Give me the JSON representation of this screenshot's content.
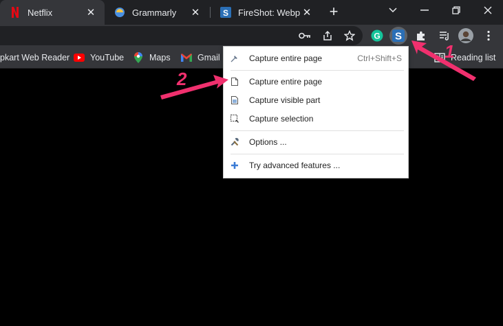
{
  "tabs": [
    {
      "title": "Netflix",
      "icon": "netflix-icon",
      "active": true
    },
    {
      "title": "Grammarly",
      "icon": "grammarly-icon",
      "active": false
    },
    {
      "title": "FireShot: Webpa",
      "icon": "fireshot-icon",
      "active": false
    }
  ],
  "bookmarks": [
    {
      "label": "pkart Web Reader",
      "icon": ""
    },
    {
      "label": "YouTube",
      "icon": "youtube-icon"
    },
    {
      "label": "Maps",
      "icon": "maps-icon"
    },
    {
      "label": "Gmail",
      "icon": "gmail-icon"
    },
    {
      "label": "Reading list",
      "icon": "reading-list-icon"
    }
  ],
  "menu": {
    "items": [
      {
        "label": "Capture entire page",
        "shortcut": "Ctrl+Shift+S",
        "icon": "capture-entire-pin-icon"
      },
      {
        "label": "Capture entire page",
        "shortcut": "",
        "icon": "page-icon"
      },
      {
        "label": "Capture visible part",
        "shortcut": "",
        "icon": "visible-part-icon"
      },
      {
        "label": "Capture selection",
        "shortcut": "",
        "icon": "selection-icon"
      },
      {
        "label": "Options ...",
        "shortcut": "",
        "icon": "tools-icon"
      },
      {
        "label": "Try advanced features ...",
        "shortcut": "",
        "icon": "plus-icon"
      }
    ]
  },
  "annotations": [
    {
      "label": "1",
      "color": "#f0306e"
    },
    {
      "label": "2",
      "color": "#f0306e"
    }
  ],
  "colors": {
    "tab_strip": "#202124",
    "toolbar": "#35363a",
    "accent_pink": "#f0306e",
    "grammarly_green": "#15c39a",
    "fireshot_blue": "#2b6fb6"
  }
}
